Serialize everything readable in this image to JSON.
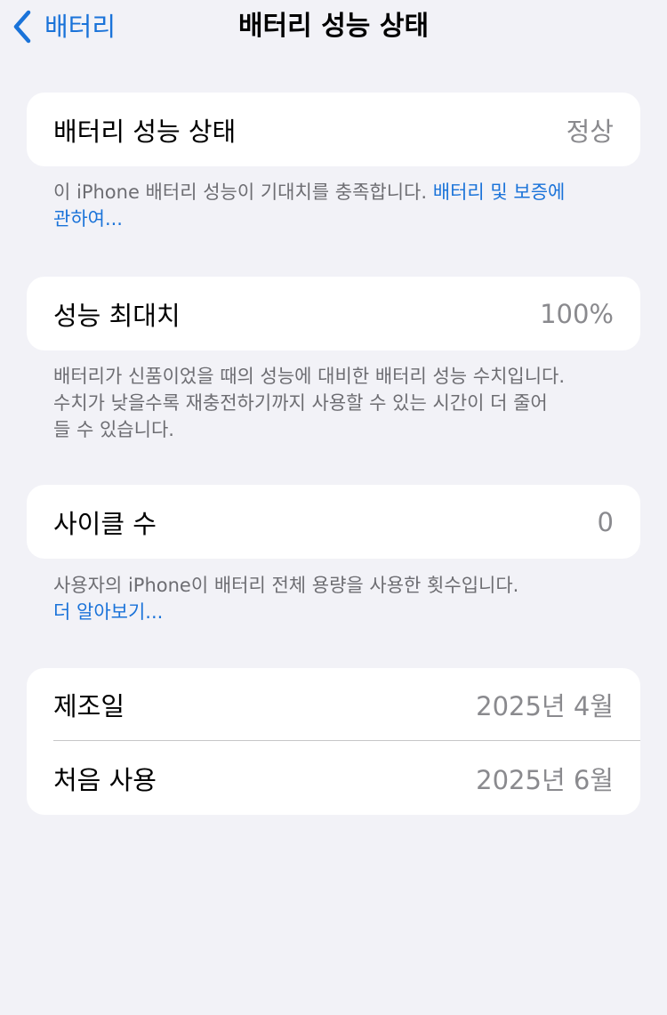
{
  "nav": {
    "back_label": "배터리",
    "title": "배터리 성능 상태"
  },
  "health": {
    "label": "배터리 성능 상태",
    "value": "정상",
    "note": "이 iPhone 배터리 성능이 기대치를 충족합니다.",
    "link_line1": "배터리 및 보증에",
    "link_line2": "관하여..."
  },
  "max_capacity": {
    "label": "성능 최대치",
    "value": "100%",
    "note_lines": [
      "배터리가 신품이었을 때의 성능에 대비한 배터리 성능 수치입니다.",
      "수치가 낮을수록 재충전하기까지 사용할 수 있는 시간이 더 줄어",
      "들 수 있습니다."
    ]
  },
  "cycle_count": {
    "label": "사이클 수",
    "value": "0",
    "note": "사용자의 iPhone이 배터리 전체 용량을 사용한 횟수입니다.",
    "link": "더 알아보기..."
  },
  "dates": [
    {
      "label": "제조일",
      "value": "2025년 4월"
    },
    {
      "label": "처음 사용",
      "value": "2025년 6월"
    }
  ],
  "colors": {
    "background": "#f2f2f7",
    "card": "#ffffff",
    "accent": "#1a73d9",
    "secondary_text": "#8a8a8e",
    "footnote_text": "#6d6d72"
  },
  "icons": {
    "back": "chevron-left-icon"
  }
}
